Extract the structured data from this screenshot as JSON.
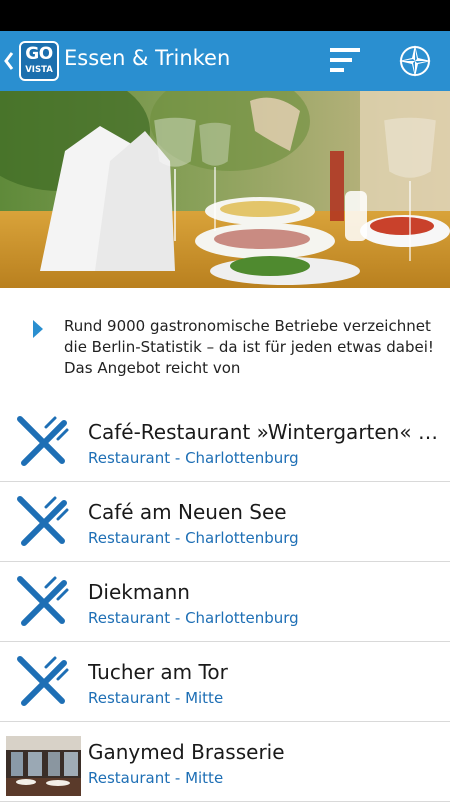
{
  "header": {
    "title": "Essen & Trinken",
    "logo_top": "GO",
    "logo_bottom": "VISTA",
    "accent_color": "#2a8fd0",
    "icons": [
      "back-chevron-icon",
      "menu-lines-icon",
      "compass-icon"
    ]
  },
  "intro": {
    "text": "Rund 9000 gastronomische Betriebe verzeichnet die Berlin-Statistik – da ist für jeden etwas dabei! Das Angebot reicht von"
  },
  "list": {
    "items": [
      {
        "name": "Café-Restaurant »Wintergarten« i…",
        "subtitle": "Restaurant - Charlottenburg",
        "icon": "fork-knife-icon"
      },
      {
        "name": "Café am Neuen See",
        "subtitle": "Restaurant - Charlottenburg",
        "icon": "fork-knife-icon"
      },
      {
        "name": "Diekmann",
        "subtitle": "Restaurant - Charlottenburg",
        "icon": "fork-knife-icon"
      },
      {
        "name": "Tucher am Tor",
        "subtitle": "Restaurant - Mitte",
        "icon": "fork-knife-icon"
      },
      {
        "name": "Ganymed Brasserie",
        "subtitle": "Restaurant - Mitte",
        "icon": "restaurant-photo"
      }
    ]
  }
}
